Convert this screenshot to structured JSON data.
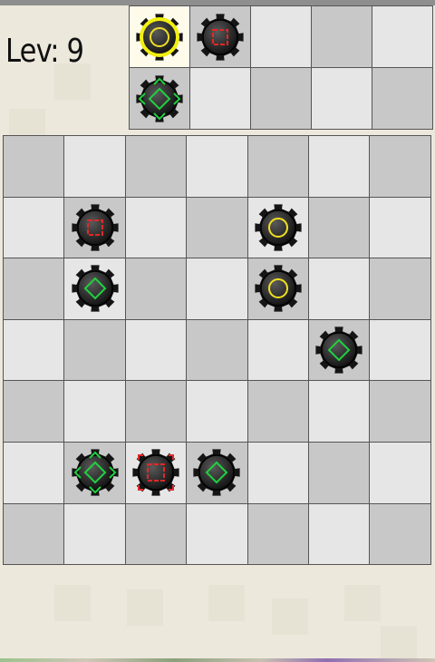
{
  "hud": {
    "level_label": "Lev: 9"
  },
  "colors": {
    "yellow": "#f0e020",
    "red": "#e02828",
    "green": "#20d040",
    "gear": "#151515",
    "selection": "#f2ef10"
  },
  "queue": {
    "cols": 5,
    "rows": 2,
    "pieces": [
      {
        "row": 0,
        "col": 0,
        "type": "circle",
        "selected": true
      },
      {
        "row": 0,
        "col": 1,
        "type": "square"
      },
      {
        "row": 1,
        "col": 0,
        "type": "diamond-arrows"
      }
    ]
  },
  "board": {
    "cols": 7,
    "rows": 7,
    "pieces": [
      {
        "row": 1,
        "col": 1,
        "type": "square"
      },
      {
        "row": 1,
        "col": 4,
        "type": "circle"
      },
      {
        "row": 2,
        "col": 1,
        "type": "diamond"
      },
      {
        "row": 2,
        "col": 4,
        "type": "circle"
      },
      {
        "row": 3,
        "col": 5,
        "type": "diamond"
      },
      {
        "row": 5,
        "col": 1,
        "type": "diamond-arrows"
      },
      {
        "row": 5,
        "col": 2,
        "type": "square-arrows"
      },
      {
        "row": 5,
        "col": 3,
        "type": "diamond"
      }
    ]
  }
}
